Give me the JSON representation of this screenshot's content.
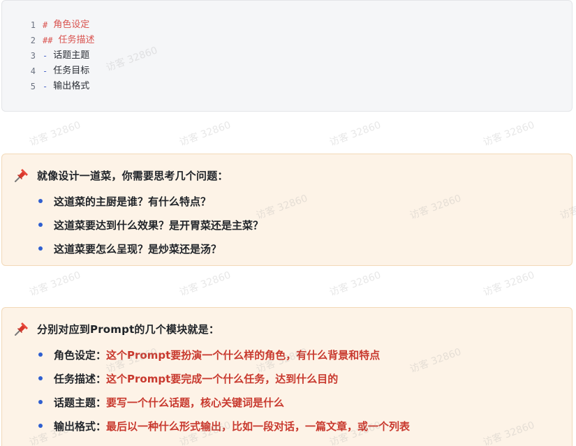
{
  "code_block": {
    "lines": [
      {
        "no": "1",
        "mark": "#",
        "text": "角色设定",
        "kind": "heading"
      },
      {
        "no": "2",
        "mark": "##",
        "text": "任务描述",
        "kind": "heading"
      },
      {
        "no": "3",
        "mark": "-",
        "text": "话题主题",
        "kind": "list"
      },
      {
        "no": "4",
        "mark": "-",
        "text": "任务目标",
        "kind": "list"
      },
      {
        "no": "5",
        "mark": "-",
        "text": "输出格式",
        "kind": "list"
      }
    ]
  },
  "callout1": {
    "icon": "pushpin-icon",
    "title": "就像设计一道菜，你需要思考几个问题：",
    "items": [
      "这道菜的主厨是谁？有什么特点？",
      "这道菜要达到什么效果？是开胃菜还是主菜？",
      "这道菜要怎么呈现？是炒菜还是汤？"
    ]
  },
  "callout2": {
    "icon": "pushpin-icon",
    "title": "分别对应到Prompt的几个模块就是：",
    "items": [
      {
        "label": "角色设定：",
        "desc": "这个Prompt要扮演一个什么样的角色，有什么背景和特点"
      },
      {
        "label": "任务描述：",
        "desc": "这个Prompt要完成一个什么任务，达到什么目的"
      },
      {
        "label": "话题主题：",
        "desc": "要写一个什么话题，核心关键词是什么"
      },
      {
        "label": "输出格式：",
        "desc": "最后以一种什么形式输出，比如一段对话，一篇文章，或一个列表"
      }
    ]
  },
  "watermark": "访客 32860",
  "colors": {
    "heading_red": "#d9534f",
    "accent_red": "#c8392e",
    "bullet_blue": "#2f5fd0",
    "callout_bg": "#fdf3e7",
    "code_bg": "#f5f6f8"
  }
}
